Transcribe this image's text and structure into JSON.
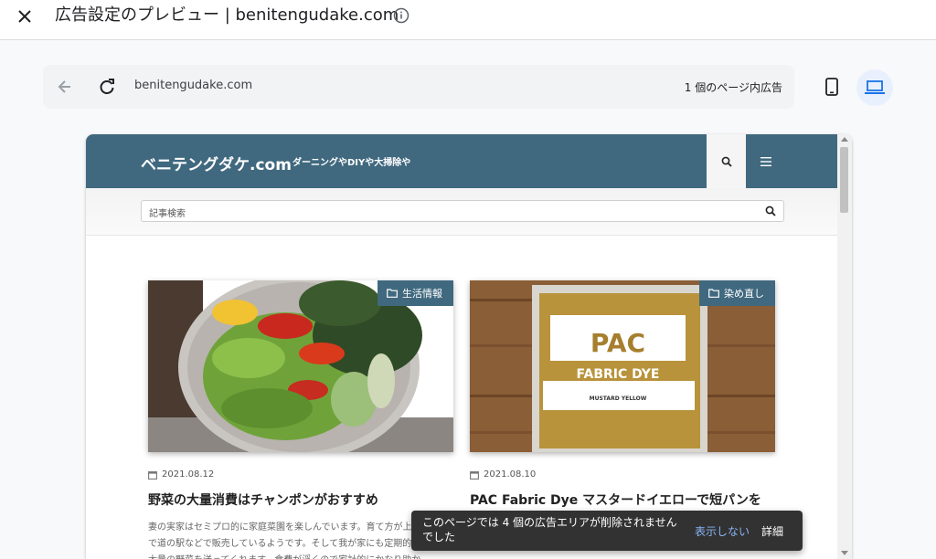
{
  "dialog": {
    "title": "広告設定のプレビュー | benitengudake.com"
  },
  "browser": {
    "url": "benitengudake.com",
    "ads_on_page": "1 個のページ内広告"
  },
  "site": {
    "logo": "ベニテングダケ.com",
    "tagline": "ダーニングやDIYや大掃除や",
    "search_placeholder": "記事検索",
    "brand_color": "#40697f"
  },
  "posts": [
    {
      "category": "生活情報",
      "date": "2021.08.12",
      "title": "野菜の大量消費はチャンポンがおすすめ",
      "excerpt": "妻の実家はセミプロ的に家庭菜園を楽しんでいます。育て方が上手で道の駅などで販売しているようです。そして我が家にも定期的に大量の野菜を送ってくれます。食費が浮くので家計的にかなり助か"
    },
    {
      "category": "染め直し",
      "date": "2021.08.10",
      "title": "PAC Fabric Dye マスタードイエローで短パンを",
      "excerpt": "",
      "package_title": "PAC",
      "package_subtitle": "FABRIC DYE",
      "package_color": "MUSTARD YELLOW"
    }
  ],
  "toast": {
    "message": "このページでは 4 個の広告エリアが削除されませんでした",
    "hide_label": "表示しない",
    "details_label": "詳細"
  }
}
